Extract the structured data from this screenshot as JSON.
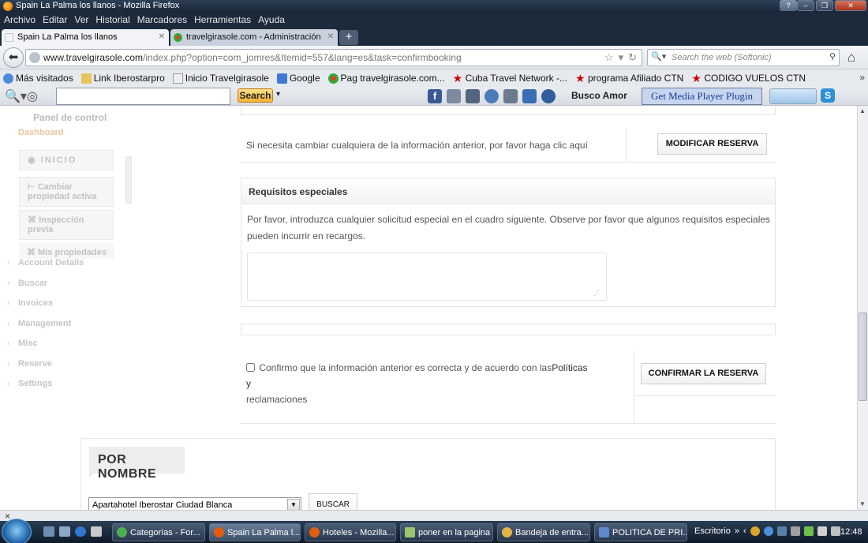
{
  "window": {
    "title": "Spain La Palma los llanos - Mozilla Firefox"
  },
  "menu": [
    "Archivo",
    "Editar",
    "Ver",
    "Historial",
    "Marcadores",
    "Herramientas",
    "Ayuda"
  ],
  "tabs": [
    {
      "label": "Spain La Palma los llanos"
    },
    {
      "label": "travelgirasole.com - Administración"
    }
  ],
  "address": {
    "domain": "www.travelgirasole.com",
    "path": "/index.php?option=com_jomres&Itemid=557&lang=es&task=confirmbooking",
    "search_placeholder": "Search the web (Softonic)"
  },
  "bookmarks": [
    "Más visitados",
    "Link Iberostarpro",
    "Inicio Travelgirasole",
    "Google",
    "Pag travelgirasole.com...",
    "Cuba Travel Network -...",
    "programa Afiliado CTN",
    "CODIGO VUELOS CTN"
  ],
  "toolbar": {
    "search_label": "Search",
    "busco": "Busco Amor",
    "media_plugin": "Get Media Player Plugin"
  },
  "sidebar": {
    "title": "Panel de control",
    "dashboard": "Dashboard",
    "inicio": "INICIO",
    "sub_items": [
      "Cambiar propiedad activa",
      "Inspección previa",
      "Mis propiedades"
    ],
    "items": [
      "Account Details",
      "Buscar",
      "Invoices",
      "Management",
      "Misc",
      "Reserve",
      "Settings"
    ]
  },
  "booking": {
    "modify_text": "Si necesita cambiar cualquiera de la información anterior, por favor haga clic aquí",
    "modify_button": "MODIFICAR RESERVA",
    "special_title": "Requisitos especiales",
    "special_text": "Por favor, introduzca cualquier solicitud especial en el cuadro siguiente. Observe por favor que algunos requisitos especiales pueden incurrir en recargos.",
    "confirm_text_1": "Confirmo que la información anterior es correcta y de acuerdo con las",
    "confirm_link": "Políticas y",
    "confirm_text_2": "reclamaciones",
    "confirm_button": "CONFIRMAR LA RESERVA"
  },
  "by_name": {
    "title": "POR NOMBRE",
    "select_value": "Apartahotel Iberostar Ciudad Blanca",
    "button": "BUSCAR"
  },
  "taskbar": {
    "tasks": [
      "Categorías - For...",
      "Spain La Palma l...",
      "Hoteles - Mozilla...",
      "poner en la pagina",
      "Bandeja de entra...",
      "POLITICA DE PRI..."
    ],
    "desktop": "Escritorio",
    "time": "12:48"
  },
  "statusbar": {
    "close": "×"
  }
}
